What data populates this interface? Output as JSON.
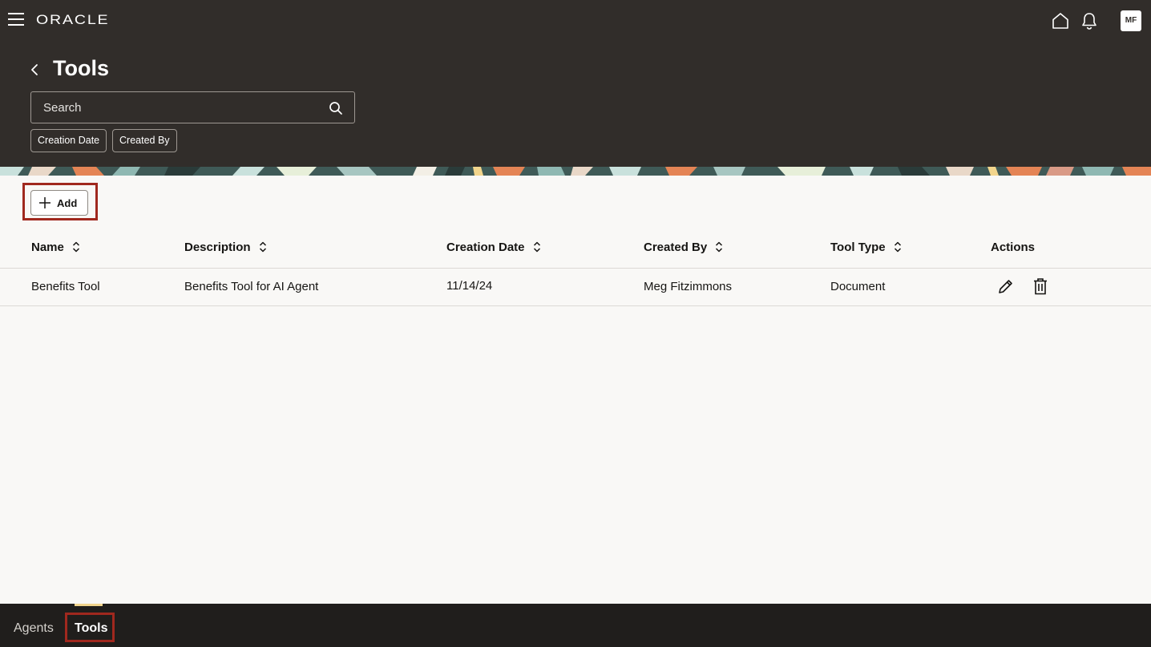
{
  "header": {
    "logo": "ORACLE",
    "avatar_initials": "MF",
    "title": "Tools",
    "icons": [
      "hamburger-menu-icon",
      "home-icon",
      "bell-icon",
      "back-icon",
      "search-icon"
    ]
  },
  "search": {
    "placeholder": "Search"
  },
  "filters": [
    {
      "label": "Creation Date"
    },
    {
      "label": "Created By"
    }
  ],
  "toolbar": {
    "add_label": "Add"
  },
  "table": {
    "columns": [
      "Name",
      "Description",
      "Creation Date",
      "Created By",
      "Tool Type",
      "Actions"
    ],
    "rows": [
      {
        "name": "Benefits Tool",
        "description": "Benefits Tool for AI Agent",
        "creation_date": "11/14/24",
        "created_by": "Meg Fitzimmons",
        "tool_type": "Document"
      }
    ]
  },
  "bottom_nav": {
    "tabs": [
      {
        "label": "Agents",
        "selected": false
      },
      {
        "label": "Tools",
        "selected": true
      }
    ]
  },
  "colors": {
    "header_bg": "#312d2a",
    "page_bg": "#f9f8f6",
    "highlight": "#a0281e",
    "bottom_bg": "#201e1c",
    "tab_indicator": "#f2d58c"
  }
}
